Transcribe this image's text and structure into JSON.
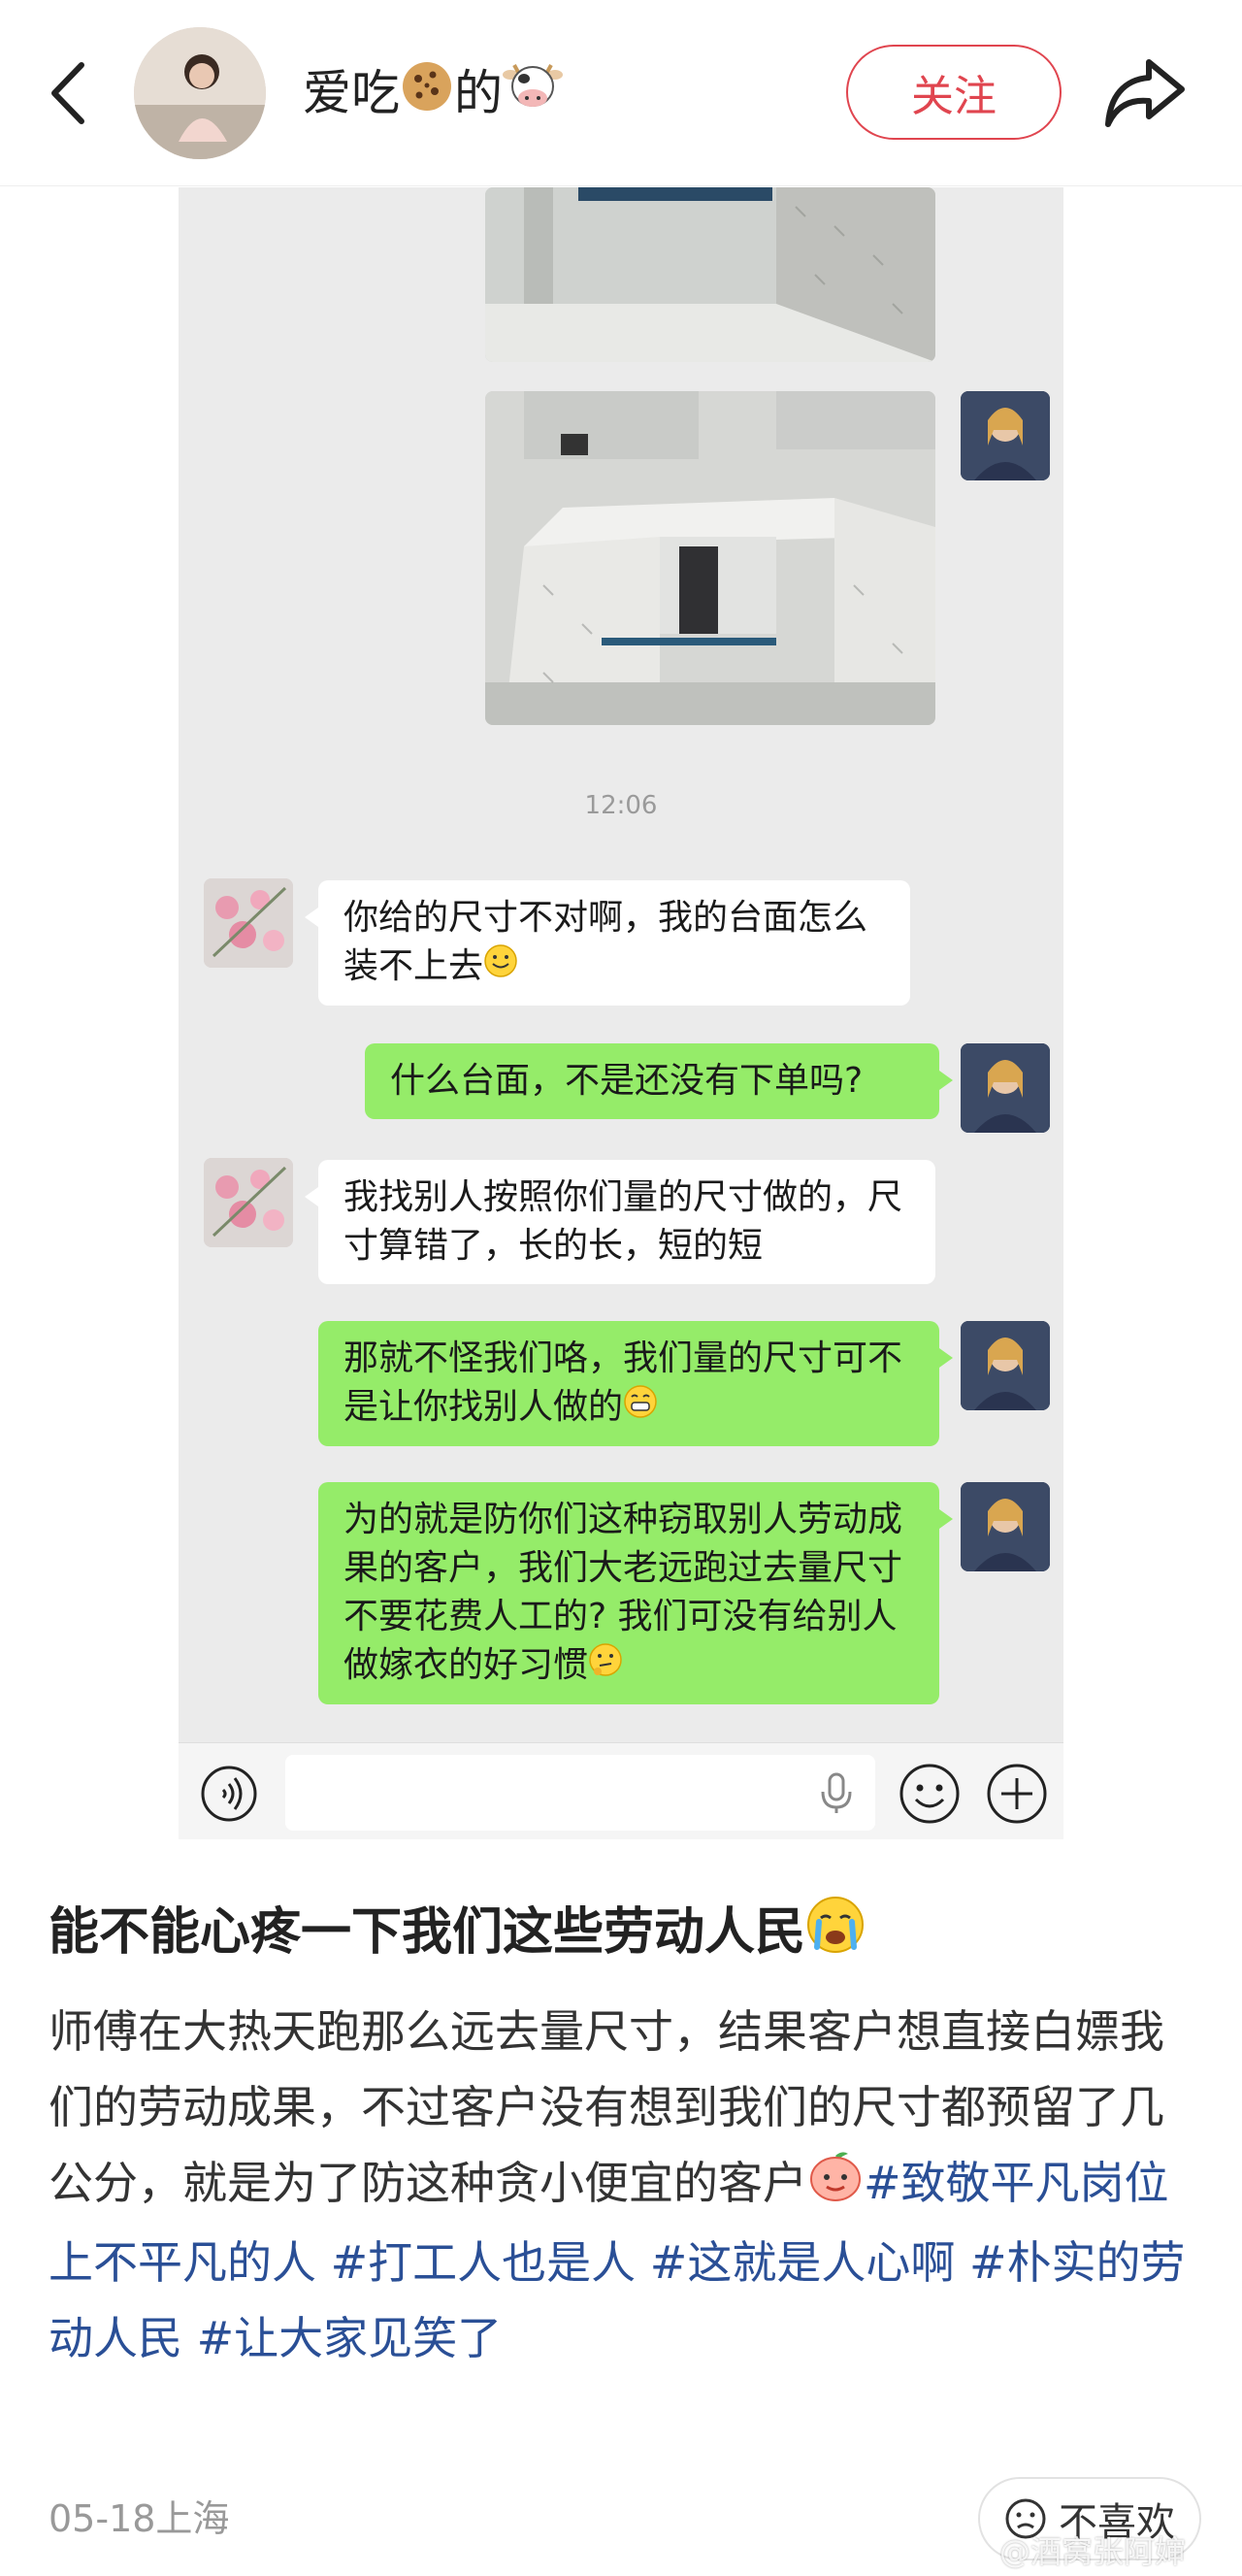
{
  "header": {
    "username_parts": [
      "爱吃",
      "的"
    ],
    "follow_label": "关注"
  },
  "chat": {
    "timestamp": "12:06",
    "messages": [
      {
        "side": "left",
        "text": "你给的尺寸不对啊，我的台面怎么装不上去"
      },
      {
        "side": "right",
        "text": "什么台面，不是还没有下单吗?"
      },
      {
        "side": "left",
        "text": "我找别人按照你们量的尺寸做的，尺寸算错了，长的长，短的短"
      },
      {
        "side": "right",
        "text": "那就不怪我们咯，我们量的尺寸可不是让你找别人做的"
      },
      {
        "side": "right",
        "text": "为的就是防你们这种窃取别人劳动成果的客户，我们大老远跑过去量尺寸不要花费人工的? 我们可没有给别人做嫁衣的好习惯"
      }
    ],
    "input_placeholder": ""
  },
  "post": {
    "title": "能不能心疼一下我们这些劳动人民",
    "body": "师傅在大热天跑那么远去量尺寸，结果客户想直接白嫖我们的劳动成果，不过客户没有想到我们的尺寸都预留了几公分，就是为了防这种贪小便宜的客户",
    "hashtags": [
      "#致敬平凡岗位上不平凡的人",
      "#打工人也是人",
      "#这就是人心啊",
      "#朴实的劳动人民",
      "#让大家见笑了"
    ],
    "meta": "05-18上海",
    "dislike_label": "不喜欢"
  },
  "watermark": "@酒窝张阿婶",
  "icons": [
    "back-arrow-icon",
    "cookie-icon",
    "cow-icon",
    "share-icon",
    "smile-emoji",
    "grin-emoji",
    "think-emoji",
    "crying-emoji",
    "peach-emoji",
    "voice-icon",
    "mic-icon",
    "emoji-icon",
    "plus-icon",
    "dislike-icon"
  ]
}
